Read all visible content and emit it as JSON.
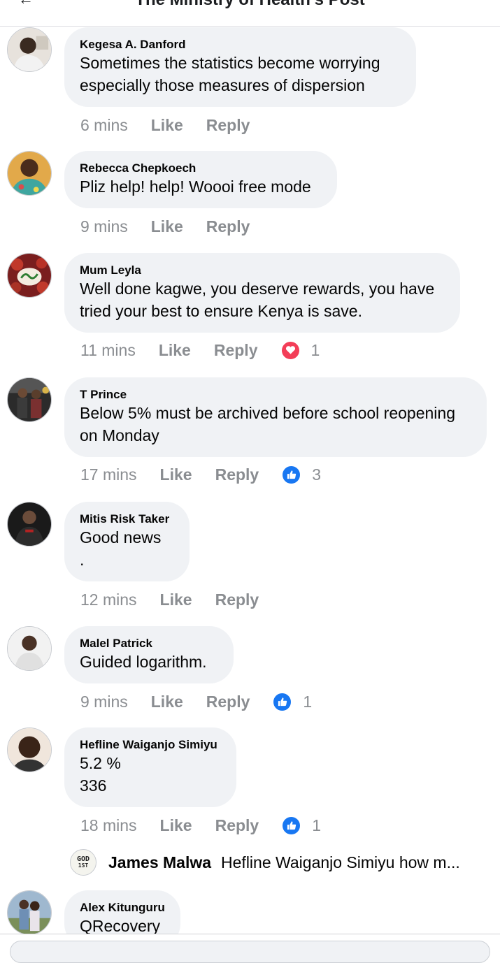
{
  "header": {
    "title": "The Ministry of Health's Post",
    "back_glyph": "←"
  },
  "comments": [
    {
      "author": "Kegesa A. Danford",
      "text": "Sometimes the statistics become worrying\nespecially those measures of dispersion",
      "time": "6 mins",
      "like": "Like",
      "reply": "Reply",
      "reaction": null,
      "avatar": "person-avatar"
    },
    {
      "author": "Rebecca Chepkoech",
      "text": "Pliz help! help! Woooi free mode",
      "time": "9 mins",
      "like": "Like",
      "reply": "Reply",
      "reaction": null,
      "avatar": "person-avatar"
    },
    {
      "author": "Mum Leyla",
      "text": "Well done kagwe, you deserve rewards, you have\ntried your best to ensure Kenya is save.",
      "time": "11 mins",
      "like": "Like",
      "reply": "Reply",
      "reaction": {
        "type": "love",
        "count": "1",
        "icon": "heart-reaction-icon"
      },
      "avatar": "calligraphy-avatar"
    },
    {
      "author": "T Prince",
      "text": "Below 5% must be archived before school reopening\non Monday",
      "time": "17 mins",
      "like": "Like",
      "reply": "Reply",
      "reaction": {
        "type": "like",
        "count": "3",
        "icon": "thumbs-up-reaction-icon"
      },
      "avatar": "group-photo-avatar"
    },
    {
      "author": "Mitis Risk Taker",
      "text": "Good news\n.",
      "time": "12 mins",
      "like": "Like",
      "reply": "Reply",
      "reaction": null,
      "avatar": "person-avatar"
    },
    {
      "author": "Malel Patrick",
      "text": "Guided logarithm.",
      "time": "9 mins",
      "like": "Like",
      "reply": "Reply",
      "reaction": {
        "type": "like",
        "count": "1",
        "icon": "thumbs-up-reaction-icon"
      },
      "avatar": "person-avatar"
    },
    {
      "author": "Hefline Waiganjo Simiyu",
      "text": "5.2 %\n336",
      "time": "18 mins",
      "like": "Like",
      "reply": "Reply",
      "reaction": {
        "type": "like",
        "count": "1",
        "icon": "thumbs-up-reaction-icon"
      },
      "avatar": "person-avatar"
    },
    {
      "author": "Alex Kitunguru",
      "text": "QRecovery",
      "time": "",
      "like": "",
      "reply": "",
      "reaction": null,
      "avatar": "couple-photo-avatar"
    }
  ],
  "reply_preview": {
    "avatar_line1": "GOD",
    "avatar_line2": "1ST",
    "author": "James Malwa",
    "text": "Hefline Waiganjo Simiyu how m..."
  },
  "colors": {
    "bubble": "#f0f2f5",
    "meta_text": "#8a8d91",
    "like_blue": "#1877f2",
    "love_red": "#f33e58"
  }
}
